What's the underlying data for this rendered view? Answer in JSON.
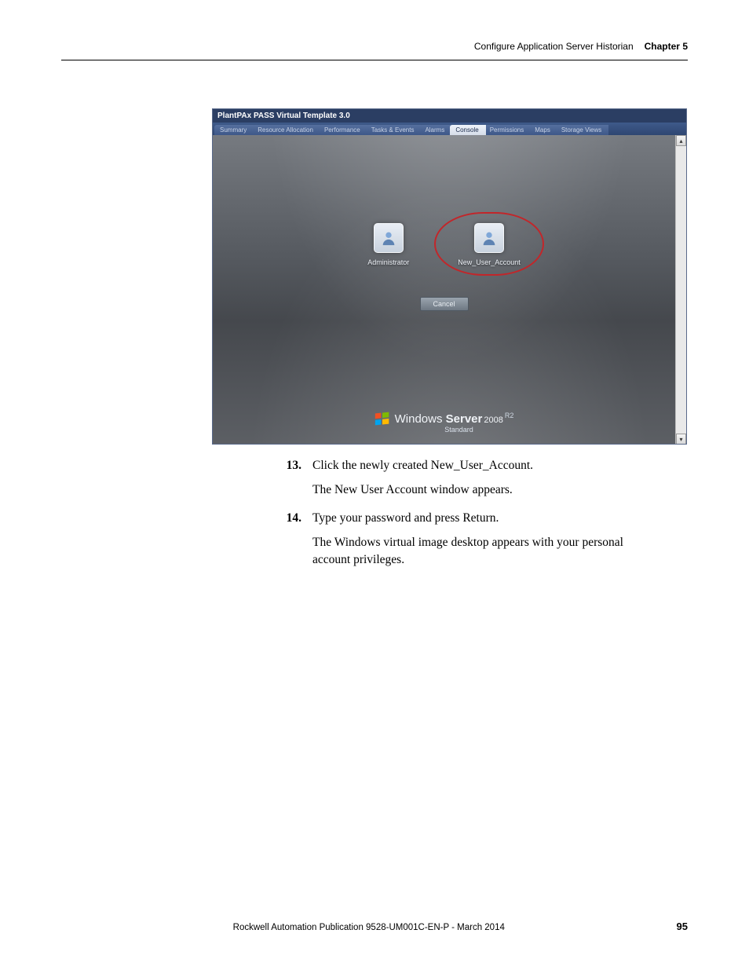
{
  "header": {
    "section": "Configure Application Server Historian",
    "chapter": "Chapter 5"
  },
  "screenshot": {
    "title": "PlantPAx PASS Virtual Template 3.0",
    "tabs": [
      {
        "label": "Summary"
      },
      {
        "label": "Resource Allocation"
      },
      {
        "label": "Performance"
      },
      {
        "label": "Tasks & Events"
      },
      {
        "label": "Alarms"
      },
      {
        "label": "Console"
      },
      {
        "label": "Permissions"
      },
      {
        "label": "Maps"
      },
      {
        "label": "Storage Views"
      }
    ],
    "accounts": {
      "admin": "Administrator",
      "new_user": "New_User_Account"
    },
    "cancel": "Cancel",
    "branding": {
      "line1_a": "Windows",
      "line1_b": "Server",
      "year": "2008",
      "r2": "R2",
      "edition": "Standard"
    }
  },
  "steps": {
    "s13_num": "13.",
    "s13_text": "Click the newly created New_User_Account.",
    "s13_follow": "The New User Account window appears.",
    "s14_num": "14.",
    "s14_text": "Type your password and press Return.",
    "s14_follow": "The Windows virtual image desktop appears with your personal account privileges."
  },
  "footer": {
    "publication": "Rockwell Automation Publication 9528-UM001C-EN-P - March 2014",
    "page": "95"
  }
}
